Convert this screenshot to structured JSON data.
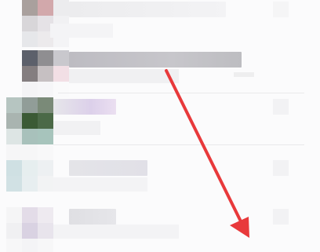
{
  "chat_list": {
    "items": [
      {
        "name": "",
        "preview": "",
        "time": ""
      },
      {
        "name": "",
        "preview": "",
        "time": ""
      },
      {
        "name": "",
        "preview": "",
        "time": ""
      },
      {
        "name": "",
        "preview": "",
        "time": ""
      },
      {
        "name": "",
        "preview": "",
        "time": ""
      }
    ]
  },
  "annotation": {
    "arrow_color": "#e8393b"
  }
}
